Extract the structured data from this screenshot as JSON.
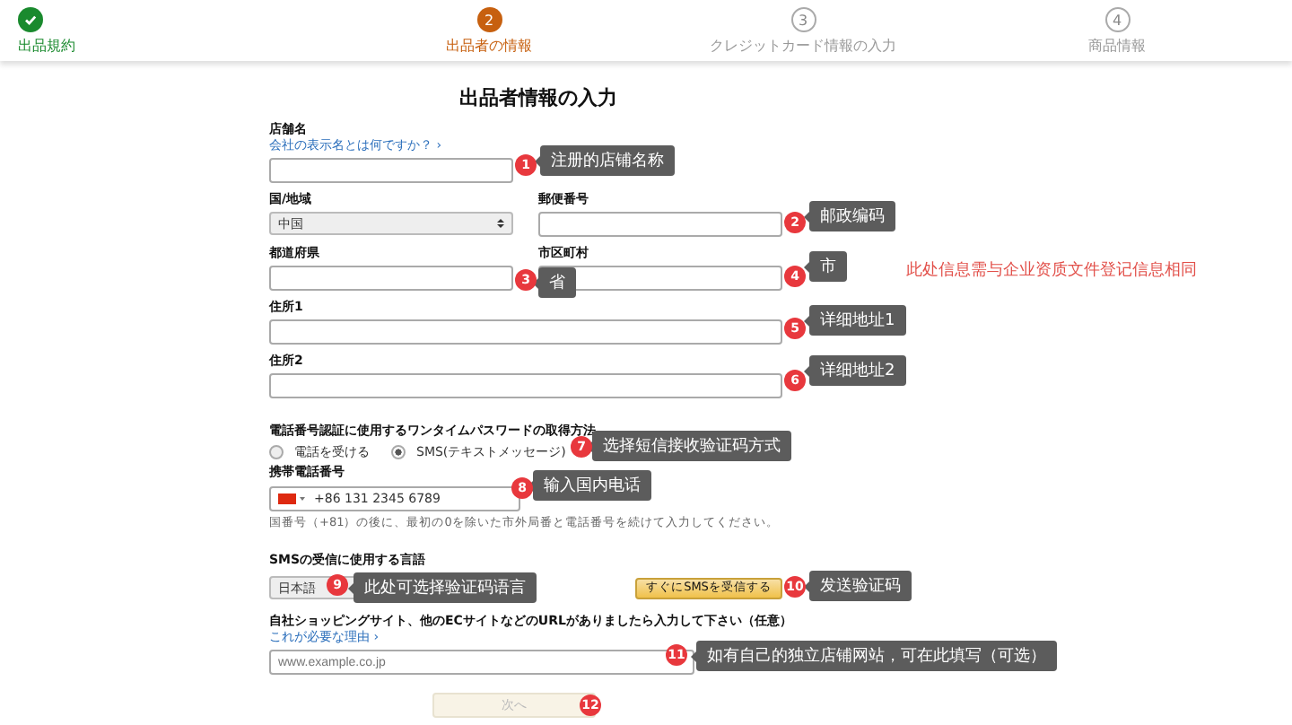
{
  "steps": [
    {
      "label": "出品規約",
      "kind": "done"
    },
    {
      "label": "出品者の情報",
      "number": "2",
      "kind": "current"
    },
    {
      "label": "クレジットカード情報の入力",
      "number": "3",
      "kind": "pending"
    },
    {
      "label": "商品情報",
      "number": "4",
      "kind": "pending"
    }
  ],
  "title": "出品者情報の入力",
  "store": {
    "label": "店舗名",
    "link": "会社の表示名とは何ですか？ ›"
  },
  "country": {
    "label": "国/地域",
    "value": "中国"
  },
  "postal": {
    "label": "郵便番号"
  },
  "prefecture": {
    "label": "都道府県"
  },
  "city": {
    "label": "市区町村"
  },
  "address1": {
    "label": "住所1"
  },
  "address2": {
    "label": "住所2"
  },
  "otp": {
    "label": "電話番号認証に使用するワンタイムパスワードの取得方法",
    "options": [
      {
        "label": "電話を受ける",
        "selected": false
      },
      {
        "label": "SMS(テキストメッセージ)",
        "selected": true
      }
    ]
  },
  "phone": {
    "label": "携帯電話番号",
    "value": "+86 131 2345 6789",
    "hint": "国番号（+81）の後に、最初の0を除いた市外局番と電話番号を続けて入力してください。"
  },
  "sms_language": {
    "label": "SMSの受信に使用する言語",
    "value": "日本語",
    "button": "すぐにSMSを受信する"
  },
  "website": {
    "label": "自社ショッピングサイト、他のECサイトなどのURLがありましたら入力して下さい（任意）",
    "link": "これが必要な理由 ›",
    "placeholder": "www.example.co.jp"
  },
  "next_button": "次へ",
  "note": "此处信息需与企业资质文件登记信息相同",
  "callouts": [
    {
      "number": "1",
      "text": "注册的店铺名称"
    },
    {
      "number": "2",
      "text": "邮政编码"
    },
    {
      "number": "3",
      "text": "省"
    },
    {
      "number": "4",
      "text": "市"
    },
    {
      "number": "5",
      "text": "详细地址1"
    },
    {
      "number": "6",
      "text": "详细地址2"
    },
    {
      "number": "7",
      "text": "选择短信接收验证码方式"
    },
    {
      "number": "8",
      "text": "输入国内电话"
    },
    {
      "number": "9",
      "text": "此处可选择验证码语言"
    },
    {
      "number": "10",
      "text": "发送验证码"
    },
    {
      "number": "11",
      "text": "如有自己的独立店铺网站，可在此填写（可选）"
    },
    {
      "number": "12"
    }
  ]
}
